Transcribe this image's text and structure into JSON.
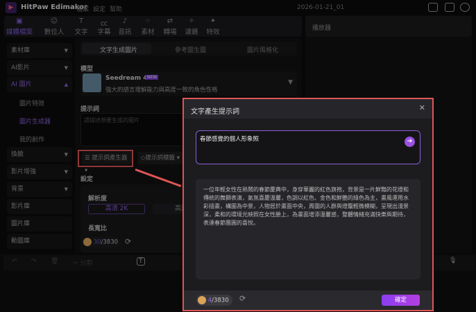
{
  "app": {
    "title": "HitPaw Edimakor",
    "menu": [
      "檔案",
      "設定",
      "幫助"
    ],
    "project": "2026-01-21_01"
  },
  "toolbar": [
    {
      "label": "媒體檔案",
      "icon": "image-icon",
      "active": true
    },
    {
      "label": "數位人",
      "icon": "person-icon"
    },
    {
      "label": "文字",
      "icon": "text-icon"
    },
    {
      "label": "字幕",
      "icon": "caption-icon"
    },
    {
      "label": "音訊",
      "icon": "music-icon"
    },
    {
      "label": "素材",
      "icon": "grid-icon"
    },
    {
      "label": "轉場",
      "icon": "transition-icon"
    },
    {
      "label": "濾鏡",
      "icon": "sparkle-icon"
    },
    {
      "label": "特效",
      "icon": "effect-icon"
    }
  ],
  "sidebar": {
    "items": [
      {
        "label": "素材庫"
      },
      {
        "label": "AI影片"
      },
      {
        "label": "AI 圖片",
        "active": true
      },
      {
        "label": "換臉"
      },
      {
        "label": "影片增強"
      },
      {
        "label": "背景"
      },
      {
        "label": "影片庫"
      },
      {
        "label": "圖片庫"
      },
      {
        "label": "動圖庫"
      }
    ],
    "subitems": [
      {
        "label": "圖片特效"
      },
      {
        "label": "圖片生成器",
        "active": true
      },
      {
        "label": "我的創作"
      }
    ]
  },
  "main": {
    "tabs": [
      "文字生成圖片",
      "參考圖生圖",
      "圖片風格化"
    ],
    "model_label": "模型",
    "model_name": "Seedream 4.0",
    "model_badge": "NEW",
    "model_desc": "強大的語言理解能力與高度一致的角色性格",
    "prompt_label": "提示詞",
    "prompt_placeholder": "請描述想要生成的圖片",
    "prompt_gen_button": "提示詞產生器",
    "prompt_tag_button": "提示詞標籤",
    "settings_label": "設定",
    "resolution_label": "解析度",
    "resolution_options": [
      "高清 2K",
      "高清"
    ],
    "aspect_label": "長寬比",
    "credits_used": "30",
    "credits_total": "/3830"
  },
  "player": {
    "title": "播放器"
  },
  "timeline": {
    "split_label": "分割"
  },
  "modal": {
    "title": "文字產生提示詞",
    "input": "春節感覺的個人形象照",
    "result": "一位年輕女性在熱鬧的春節慶典中，身穿華麗的紅色旗袍，背景是一片鮮豔的花燈和傳統的舞獅表演，氣氛喜慶溫馨，色調以紅色、金色和鮮艷的綠色為主，畫風運用水彩插畫，構圖為中景，人物居於畫面中央，周圍的人群與燈籠輕微模糊，呈現出淺景深，柔和的環境光映照在女性臉上，為畫面增添溫馨感，整體情緒充滿快樂與期待，表達春節團圓的喜悅。",
    "credits_used": "4",
    "credits_total": "/3830",
    "confirm": "確定"
  },
  "colors": {
    "accent": "#8a5fd6",
    "highlight": "#e05555"
  }
}
